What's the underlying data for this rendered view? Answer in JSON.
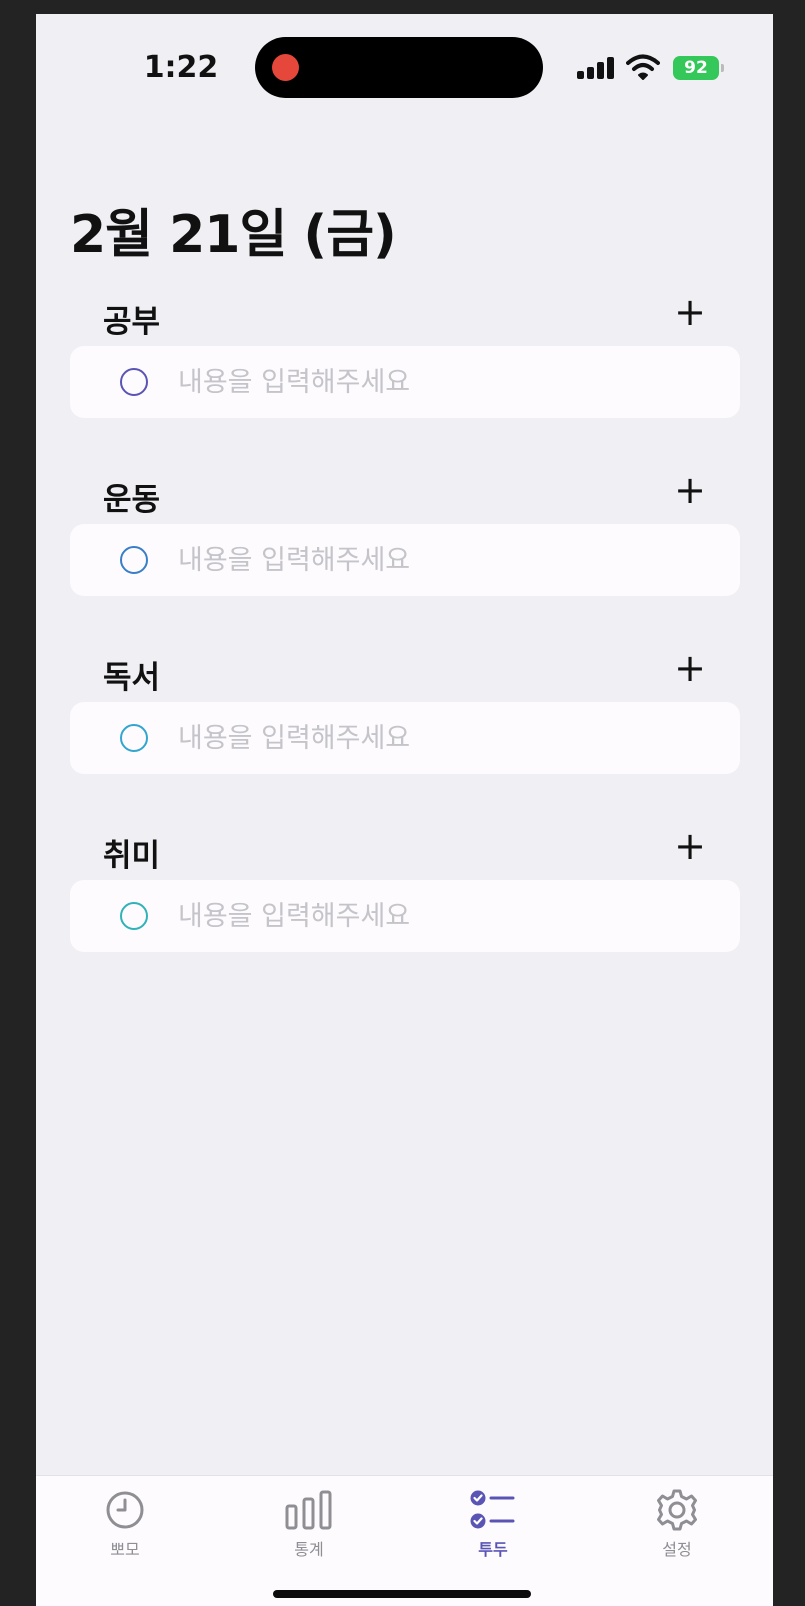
{
  "status": {
    "time": "1:22",
    "battery": "92"
  },
  "date_title": "2월 21일 (금)",
  "sections": [
    {
      "title": "공부",
      "placeholder": "내용을 입력해주세요",
      "color": "#5a55b5"
    },
    {
      "title": "운동",
      "placeholder": "내용을 입력해주세요",
      "color": "#3a7fc6"
    },
    {
      "title": "독서",
      "placeholder": "내용을 입력해주세요",
      "color": "#32a6cf"
    },
    {
      "title": "취미",
      "placeholder": "내용을 입력해주세요",
      "color": "#2fb3b8"
    }
  ],
  "add_icon": "+",
  "tabs": [
    {
      "label": "뽀모",
      "icon": "clock-icon"
    },
    {
      "label": "통계",
      "icon": "bar-chart-icon"
    },
    {
      "label": "투두",
      "icon": "checklist-icon",
      "active": true
    },
    {
      "label": "설정",
      "icon": "gear-icon"
    }
  ],
  "colors": {
    "accent": "#5a55b5",
    "background": "#f0f0f4",
    "card": "#fdfbfe"
  }
}
